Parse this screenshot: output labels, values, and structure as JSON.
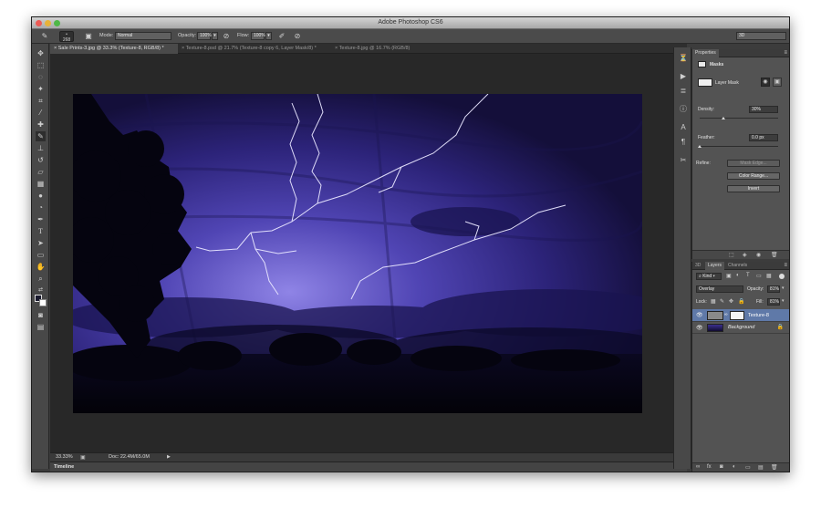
{
  "window": {
    "title": "Adobe Photoshop CS6"
  },
  "options": {
    "brush_size": "268",
    "mode_label": "Mode:",
    "mode_value": "Normal",
    "opacity_label": "Opacity:",
    "opacity_value": "100%",
    "flow_label": "Flow:",
    "flow_value": "100%",
    "workspace_value": "3D"
  },
  "tabs": [
    {
      "label": "Sale Prints-3.jpg @ 33.3% (Texture-8, RGB/8) *",
      "active": true
    },
    {
      "label": "Texture-8.psd @ 21.7% (Texture-8 copy 6, Layer Mask/8) *",
      "active": false
    },
    {
      "label": "Texture-8.jpg @ 16.7% (RGB/8)",
      "active": false
    }
  ],
  "status": {
    "zoom": "33.33%",
    "doc": "Doc: 22.4M/65.0M"
  },
  "timeline": {
    "label": "Timeline"
  },
  "properties": {
    "tab": "Properties",
    "masks_title": "Masks",
    "layer_mask_label": "Layer Mask",
    "density_label": "Density:",
    "density_value": "30%",
    "density": 0.3,
    "feather_label": "Feather:",
    "feather_value": "0.0 px",
    "refine_label": "Refine:",
    "mask_edge": "Mask Edge...",
    "color_range": "Color Range...",
    "invert": "Invert"
  },
  "layers_panel": {
    "tabs": [
      "3D",
      "Layers",
      "Channels"
    ],
    "active_tab": "Layers",
    "kind_label": "Kind",
    "blend_mode": "Overlay",
    "opacity_label": "Opacity:",
    "opacity_value": "81%",
    "lock_label": "Lock:",
    "fill_label": "Fill:",
    "fill_value": "81%",
    "layers": [
      {
        "name": "Texture-8",
        "selected": true
      },
      {
        "name": "Background",
        "selected": false
      }
    ]
  },
  "colors": {
    "accent": "#5f79a8",
    "sky": "#3b2f8f",
    "window": "#3c3c3c"
  }
}
